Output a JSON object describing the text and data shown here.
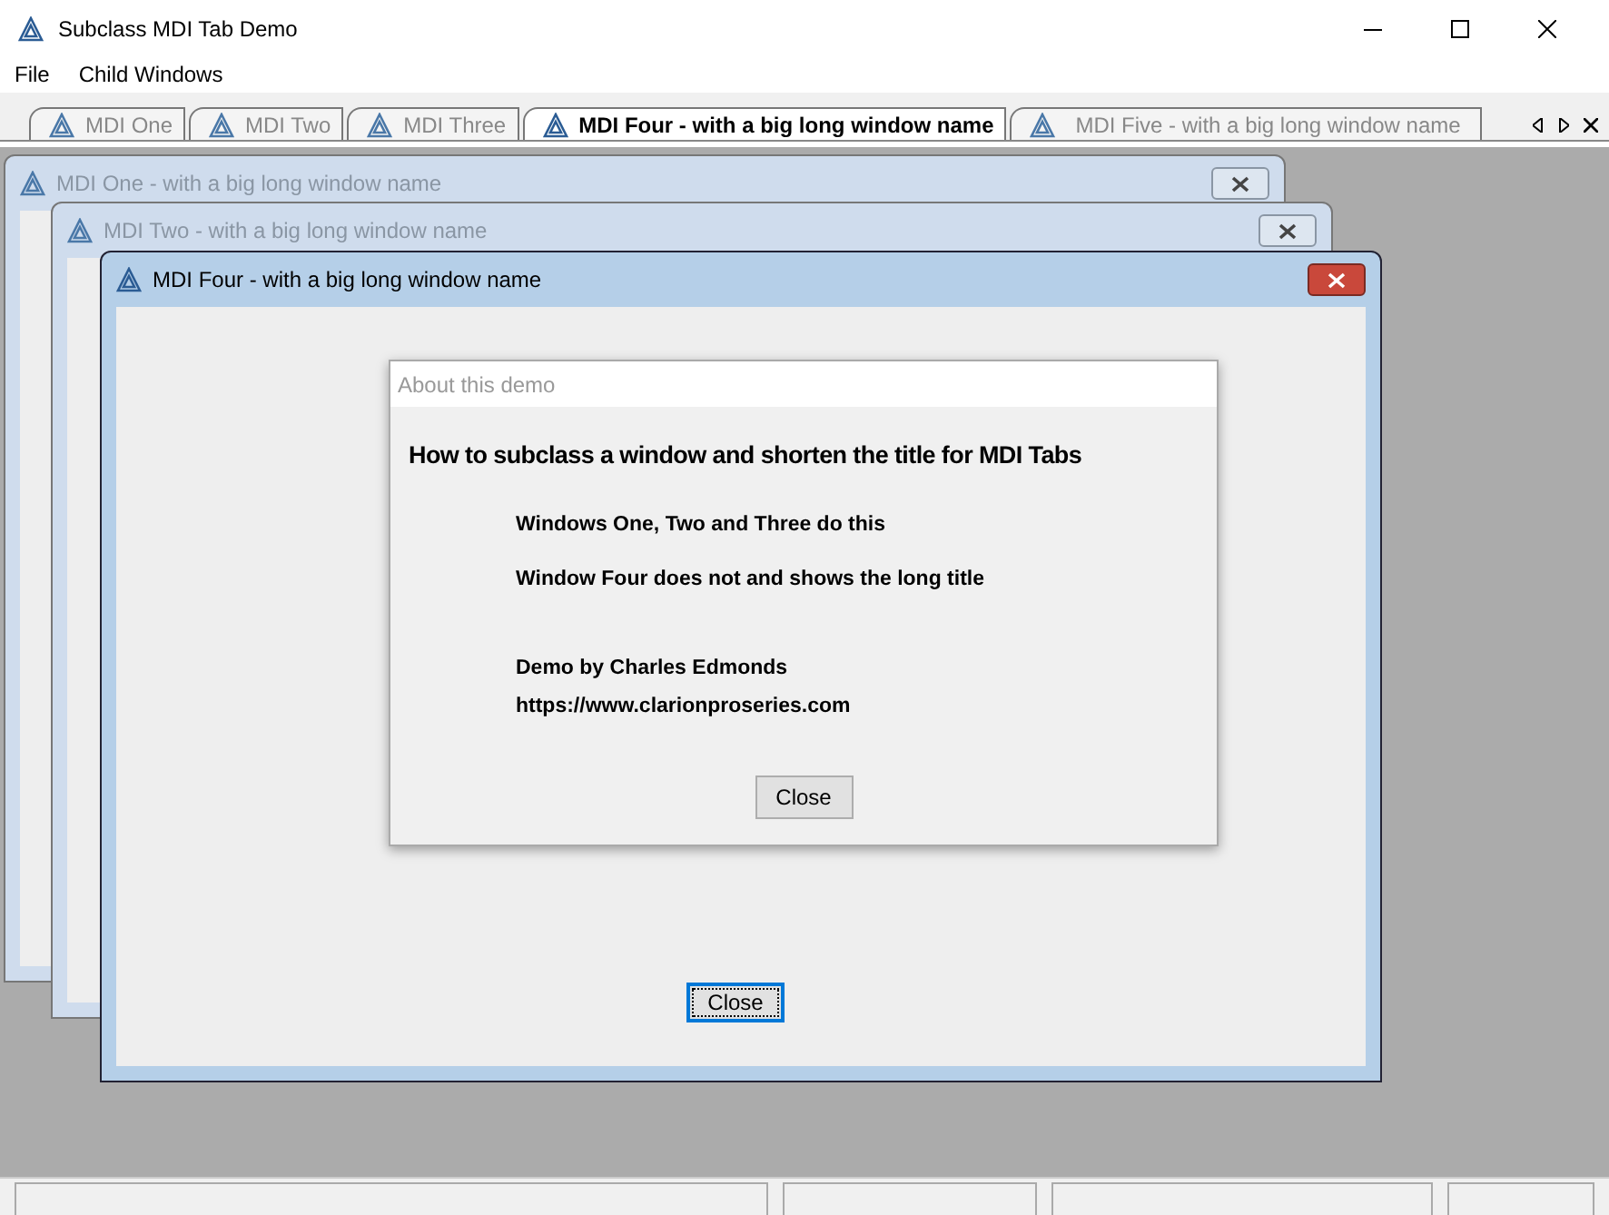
{
  "window": {
    "title": "Subclass MDI Tab Demo"
  },
  "menu": [
    "File",
    "Child Windows"
  ],
  "tabs": [
    {
      "label": "MDI One",
      "selected": false
    },
    {
      "label": "MDI Two",
      "selected": false
    },
    {
      "label": "MDI Three",
      "selected": false
    },
    {
      "label": "MDI Four - with a big long window name",
      "selected": true
    },
    {
      "label": "MDI Five - with a big long window name",
      "selected": false
    }
  ],
  "child_windows": [
    {
      "title": "MDI One - with a big long window name",
      "active": false
    },
    {
      "title": "MDI Two - with a big long window name",
      "active": false
    },
    {
      "title": "MDI Four - with a big long window name",
      "active": true,
      "button": "Close",
      "dialog": {
        "title": "About this demo",
        "heading": "How to subclass a window and shorten the title for MDI Tabs",
        "lines": [
          "Windows One, Two and Three do this",
          "Window Four does not and shows the long title"
        ],
        "credits": [
          "Demo by Charles Edmonds",
          "https://www.clarionproseries.com"
        ],
        "button": "Close"
      }
    }
  ]
}
